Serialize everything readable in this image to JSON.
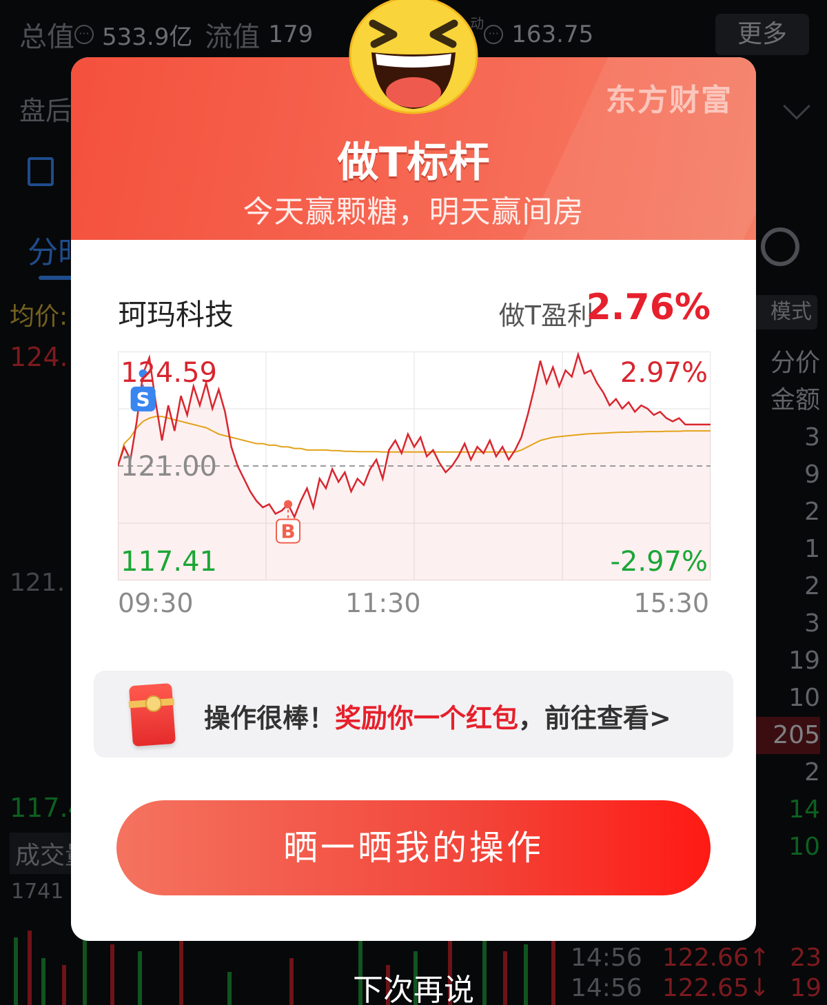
{
  "background": {
    "header": {
      "total_value_label": "总值",
      "total_value": "533.9亿",
      "float_value_label": "流值",
      "float_value": "179",
      "dynamic_mark": "动",
      "pe_value": "163.75",
      "more_label": "更多"
    },
    "after_hours_label": "盘后",
    "tab_label": "分时",
    "avg_price_label": "均价:",
    "price_high": "124.",
    "price_mid": "121.",
    "price_low": "117.4",
    "volume_label": "成交量",
    "volume_value": "1741",
    "mode_label": "模式",
    "side_labels": [
      "分价",
      "金额"
    ],
    "side_values": [
      "3",
      "9",
      "2",
      "1",
      "2",
      "3",
      "19",
      "10",
      "205",
      "2",
      "14",
      "10",
      "23",
      "19"
    ],
    "ticks": [
      {
        "time": "14:56",
        "price": "122.66↑",
        "vol": "23"
      },
      {
        "time": "14:56",
        "price": "122.65↓",
        "vol": "19"
      }
    ]
  },
  "modal": {
    "brand": "东方财富",
    "title": "做T标杆",
    "subtitle": "今天赢颗糖，明天赢间房",
    "stock_name": "珂玛科技",
    "profit_label": "做T盈利",
    "profit_value": "2.76%",
    "redpack_prefix": "操作很棒！",
    "redpack_highlight": "奖励你一个红包",
    "redpack_suffix": "，前往查看>",
    "share_button": "晒一晒我的操作",
    "dismiss": "下次再说"
  },
  "chart_data": {
    "type": "line",
    "title": "",
    "ylim": [
      117.41,
      124.59
    ],
    "ref_price": 121.0,
    "y_labels": {
      "high": "124.59",
      "mid": "121.00",
      "low": "117.41"
    },
    "pct_labels": {
      "high": "2.97%",
      "low": "-2.97%"
    },
    "x_tick_labels": [
      "09:30",
      "11:30",
      "15:30"
    ],
    "grid": true,
    "markers": [
      {
        "label": "S",
        "time_index": 4,
        "price": 123.9
      },
      {
        "label": "B",
        "time_index": 27,
        "price": 119.8
      }
    ],
    "series": [
      {
        "color": "#d8262f",
        "values": [
          121.0,
          121.6,
          121.2,
          122.4,
          123.9,
          124.4,
          123.0,
          121.8,
          122.9,
          122.1,
          123.2,
          122.6,
          123.5,
          122.9,
          123.6,
          122.8,
          123.4,
          122.7,
          121.6,
          121.0,
          120.6,
          120.2,
          119.9,
          119.7,
          119.8,
          119.5,
          119.6,
          119.8,
          119.4,
          119.9,
          120.3,
          119.7,
          120.6,
          120.3,
          120.9,
          120.5,
          120.8,
          120.2,
          120.6,
          120.4,
          120.9,
          121.2,
          120.6,
          121.5,
          121.8,
          121.4,
          122.0,
          121.6,
          121.9,
          121.3,
          121.5,
          121.1,
          120.8,
          121.0,
          121.3,
          121.7,
          121.2,
          121.6,
          121.4,
          121.8,
          121.3,
          121.6,
          121.2,
          121.5,
          121.9,
          122.6,
          123.4,
          124.3,
          123.6,
          124.1,
          123.5,
          124.0,
          123.8,
          124.5,
          123.9,
          124.0,
          123.6,
          123.3,
          122.9,
          123.1,
          122.8,
          123.0,
          122.7,
          122.9,
          122.8,
          122.6,
          122.7,
          122.5,
          122.4,
          122.5,
          122.3,
          122.3,
          122.3,
          122.3,
          122.3
        ]
      },
      {
        "color": "#e2a21a",
        "values": [
          121.0,
          121.7,
          121.9,
          122.2,
          122.4,
          122.5,
          122.55,
          122.55,
          122.5,
          122.45,
          122.4,
          122.35,
          122.3,
          122.25,
          122.2,
          122.1,
          122.0,
          121.95,
          121.9,
          121.85,
          121.8,
          121.75,
          121.7,
          121.7,
          121.65,
          121.65,
          121.6,
          121.6,
          121.55,
          121.55,
          121.5,
          121.5,
          121.5,
          121.5,
          121.48,
          121.48,
          121.46,
          121.46,
          121.45,
          121.45,
          121.45,
          121.45,
          121.44,
          121.44,
          121.44,
          121.44,
          121.44,
          121.44,
          121.44,
          121.44,
          121.44,
          121.44,
          121.44,
          121.44,
          121.44,
          121.44,
          121.44,
          121.44,
          121.44,
          121.44,
          121.44,
          121.44,
          121.44,
          121.44,
          121.5,
          121.6,
          121.7,
          121.8,
          121.85,
          121.9,
          121.92,
          121.94,
          121.96,
          121.98,
          122.0,
          122.01,
          122.02,
          122.03,
          122.04,
          122.05,
          122.06,
          122.06,
          122.07,
          122.07,
          122.08,
          122.08,
          122.08,
          122.09,
          122.09,
          122.09,
          122.1,
          122.1,
          122.1,
          122.1,
          122.1
        ]
      }
    ]
  }
}
